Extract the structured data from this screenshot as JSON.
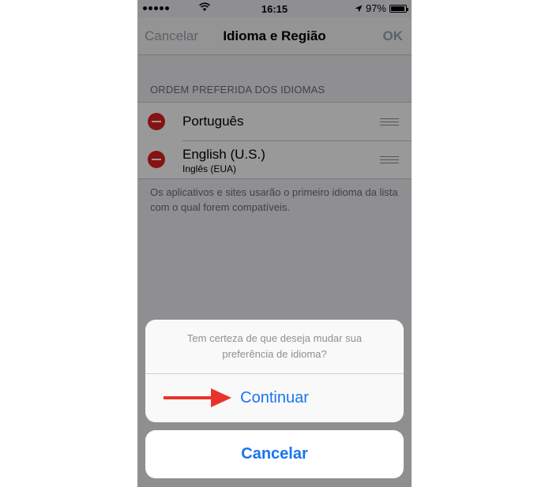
{
  "status_bar": {
    "time": "16:15",
    "battery": "97%",
    "battery_level": 0.97,
    "signal_dots": 5,
    "icons": [
      "signal-dots-icon",
      "wifi-icon",
      "location-arrow-icon",
      "battery-icon"
    ]
  },
  "nav": {
    "cancel_label": "Cancelar",
    "title": "Idioma e Região",
    "ok_label": "OK"
  },
  "languages": {
    "header": "ORDEM PREFERIDA DOS IDIOMAS",
    "items": [
      {
        "name": "Português",
        "subtitle": ""
      },
      {
        "name": "English (U.S.)",
        "subtitle": "Inglês (EUA)"
      }
    ],
    "footer": "Os aplicativos e sites usarão o primeiro idioma da lista com o qual forem compatíveis."
  },
  "action_sheet": {
    "message": "Tem certeza de que deseja mudar sua preferência de idioma?",
    "continue_label": "Continuar",
    "cancel_label": "Cancelar"
  },
  "colors": {
    "ios_blue": "#1a75f0",
    "delete_red": "#e02020",
    "annotation_arrow": "#e8332b"
  }
}
